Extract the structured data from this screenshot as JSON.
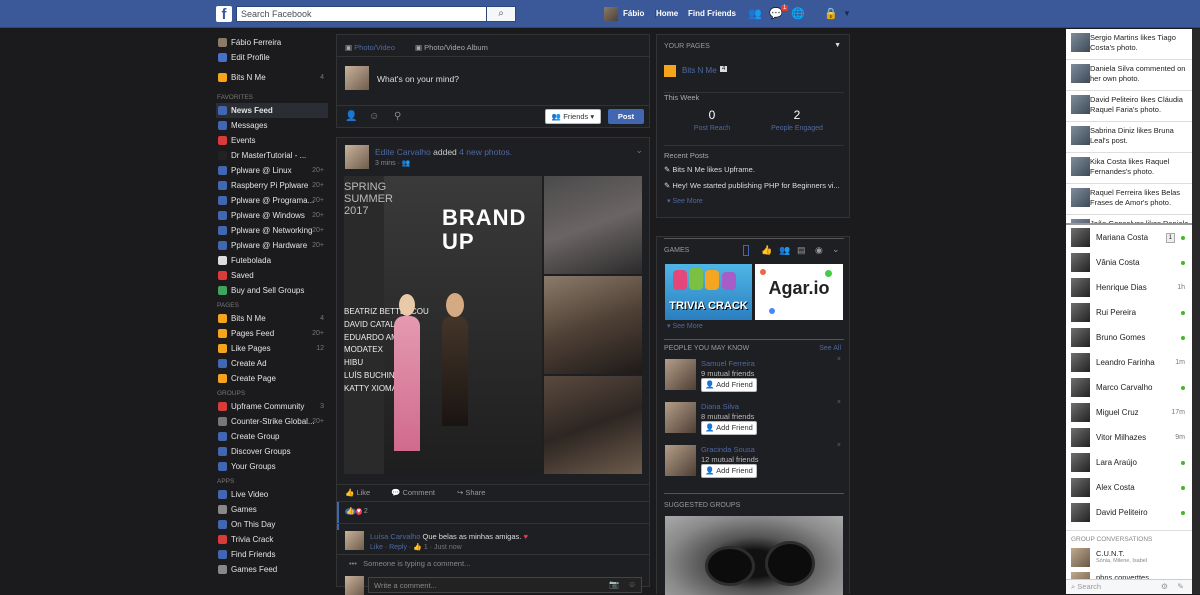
{
  "topbar": {
    "search_placeholder": "Search Facebook",
    "user_name": "Fábio",
    "home": "Home",
    "find_friends": "Find Friends",
    "notif_count": "1"
  },
  "left": {
    "profile": [
      {
        "label": "Fábio Ferreira",
        "color": "#8a7a68"
      },
      {
        "label": "Edit Profile",
        "color": "#4a6fc7"
      }
    ],
    "page": {
      "label": "Bits N Me",
      "count": "4",
      "color": "#f7a41d"
    },
    "favorites_title": "FAVORITES",
    "favorites": [
      {
        "label": "News Feed",
        "color": "#4267b2",
        "count": ""
      },
      {
        "label": "Messages",
        "color": "#4267b2",
        "count": ""
      },
      {
        "label": "Events",
        "color": "#d93a3a",
        "count": ""
      },
      {
        "label": "Dr MasterTutorial - ...",
        "color": "#222",
        "count": ""
      },
      {
        "label": "Pplware @ Linux",
        "color": "#4267b2",
        "count": "20+"
      },
      {
        "label": "Raspberry Pi Pplware",
        "color": "#4267b2",
        "count": "20+"
      },
      {
        "label": "Pplware @ Programa...",
        "color": "#4267b2",
        "count": "20+"
      },
      {
        "label": "Pplware @ Windows",
        "color": "#4267b2",
        "count": "20+"
      },
      {
        "label": "Pplware @ Networking",
        "color": "#4267b2",
        "count": "20+"
      },
      {
        "label": "Pplware @ Hardware",
        "color": "#4267b2",
        "count": "20+"
      },
      {
        "label": "Futebolada",
        "color": "#ddd",
        "count": ""
      },
      {
        "label": "Saved",
        "color": "#d93a3a",
        "count": ""
      },
      {
        "label": "Buy and Sell Groups",
        "color": "#3fa45d",
        "count": ""
      }
    ],
    "pages_title": "PAGES",
    "pages": [
      {
        "label": "Bits N Me",
        "color": "#f7a41d",
        "count": "4"
      },
      {
        "label": "Pages Feed",
        "color": "#f7a41d",
        "count": "20+"
      },
      {
        "label": "Like Pages",
        "color": "#f7a41d",
        "count": "12"
      },
      {
        "label": "Create Ad",
        "color": "#4267b2",
        "count": ""
      },
      {
        "label": "Create Page",
        "color": "#f7a41d",
        "count": ""
      }
    ],
    "groups_title": "GROUPS",
    "groups": [
      {
        "label": "Upframe Community",
        "color": "#d93a3a",
        "count": "3"
      },
      {
        "label": "Counter-Strike Global...",
        "color": "#777",
        "count": "20+"
      },
      {
        "label": "Create Group",
        "color": "#4267b2",
        "count": ""
      },
      {
        "label": "Discover Groups",
        "color": "#4267b2",
        "count": ""
      },
      {
        "label": "Your Groups",
        "color": "#4267b2",
        "count": ""
      }
    ],
    "apps_title": "APPS",
    "apps": [
      {
        "label": "Live Video",
        "color": "#4267b2"
      },
      {
        "label": "Games",
        "color": "#888"
      },
      {
        "label": "On This Day",
        "color": "#4267b2"
      },
      {
        "label": "Trivia Crack",
        "color": "#d93a3a"
      },
      {
        "label": "Find Friends",
        "color": "#4267b2"
      },
      {
        "label": "Games Feed",
        "color": "#888"
      }
    ]
  },
  "composer": {
    "tab1": "Photo/Video",
    "tab2": "Photo/Video Album",
    "prompt": "What's on your mind?",
    "audience": "Friends",
    "post_btn": "Post"
  },
  "post": {
    "author": "Edite Carvalho",
    "action": "added",
    "photos": "4 new photos.",
    "time": "3 mins",
    "banner1": "BRAND",
    "banner2": "UP",
    "banner3": "SPRING",
    "banner4": "SUMMER",
    "banner5": "2017",
    "names": [
      "BEATRIZ BETTENCOU",
      "DAVID CATALÁN",
      "EDUARDO AMO",
      "MODATEX",
      "HIBU",
      "LUÍS BUCHIN",
      "KATTY XIOMA"
    ],
    "like": "Like",
    "comment": "Comment",
    "share": "Share",
    "reactions": "2",
    "comment_author": "Luísa Carvalho",
    "comment_text": "Que belas as minhas amigas.",
    "comment_meta1": "Like",
    "comment_meta2": "Reply",
    "comment_meta3": "1",
    "comment_time": "Just now",
    "typing": "Someone is typing a comment...",
    "write": "Write a comment..."
  },
  "right": {
    "your_pages": "YOUR PAGES",
    "page_name": "Bits N Me",
    "page_count": "4",
    "this_week": "This Week",
    "post_reach_val": "0",
    "post_reach": "Post Reach",
    "engaged_val": "2",
    "engaged": "People Engaged",
    "recent_posts": "Recent Posts",
    "recent": [
      "Bits N Me likes Upframe.",
      "Hey! We started publishing PHP for Beginners vi..."
    ],
    "see_more": "See More",
    "games": "GAMES",
    "game1": "TRIVIA CRACK",
    "game2": "Agar.io",
    "see_more2": "See More",
    "pymk": "PEOPLE YOU MAY KNOW",
    "see_all": "See All",
    "people": [
      {
        "name": "Samuel Ferreira",
        "mutual": "9 mutual friends"
      },
      {
        "name": "Diana Silva",
        "mutual": "8 mutual friends"
      },
      {
        "name": "Gracinda Sousa",
        "mutual": "12 mutual friends"
      }
    ],
    "add_friend": "Add Friend",
    "suggested": "SUGGESTED GROUPS"
  },
  "ticker": [
    {
      "text": "Sergio Martins likes Tiago Costa's photo."
    },
    {
      "text": "Daniela Silva commented on her own photo."
    },
    {
      "text": "David Peliteiro likes Cláudia Raquel Faria's photo."
    },
    {
      "text": "Sabrina Diniz likes Bruna Leal's post."
    },
    {
      "text": "Kika Costa likes Raquel Fernandes's photo."
    },
    {
      "text": "Raquel Ferreira likes Belas Frases de Amor's photo."
    },
    {
      "text": "João Gonçalves likes Daniela"
    }
  ],
  "chat": [
    {
      "name": "Mariana Costa",
      "status": "online",
      "extra": "1"
    },
    {
      "name": "Vânia Costa",
      "status": "online",
      "extra": ""
    },
    {
      "name": "Henrique Dias",
      "status": "1h",
      "extra": ""
    },
    {
      "name": "Rui Pereira",
      "status": "online",
      "extra": ""
    },
    {
      "name": "Bruno Gomes",
      "status": "online",
      "extra": ""
    },
    {
      "name": "Leandro Farinha",
      "status": "1m",
      "extra": ""
    },
    {
      "name": "Marco Carvalho",
      "status": "online",
      "extra": ""
    },
    {
      "name": "Miguel Cruz",
      "status": "17m",
      "extra": ""
    },
    {
      "name": "Vitor Milhazes",
      "status": "9m",
      "extra": ""
    },
    {
      "name": "Lara Araújo",
      "status": "online",
      "extra": ""
    },
    {
      "name": "Alex Costa",
      "status": "online",
      "extra": ""
    },
    {
      "name": "David Peliteiro",
      "status": "online",
      "extra": ""
    }
  ],
  "group_conv": "GROUP CONVERSATIONS",
  "groups_chat": [
    {
      "name": "C.U.N.T.",
      "members": "Sónia, Milene, Isabel"
    },
    {
      "name": "pbns converttes",
      "members": ""
    }
  ],
  "chat_search": "Search"
}
